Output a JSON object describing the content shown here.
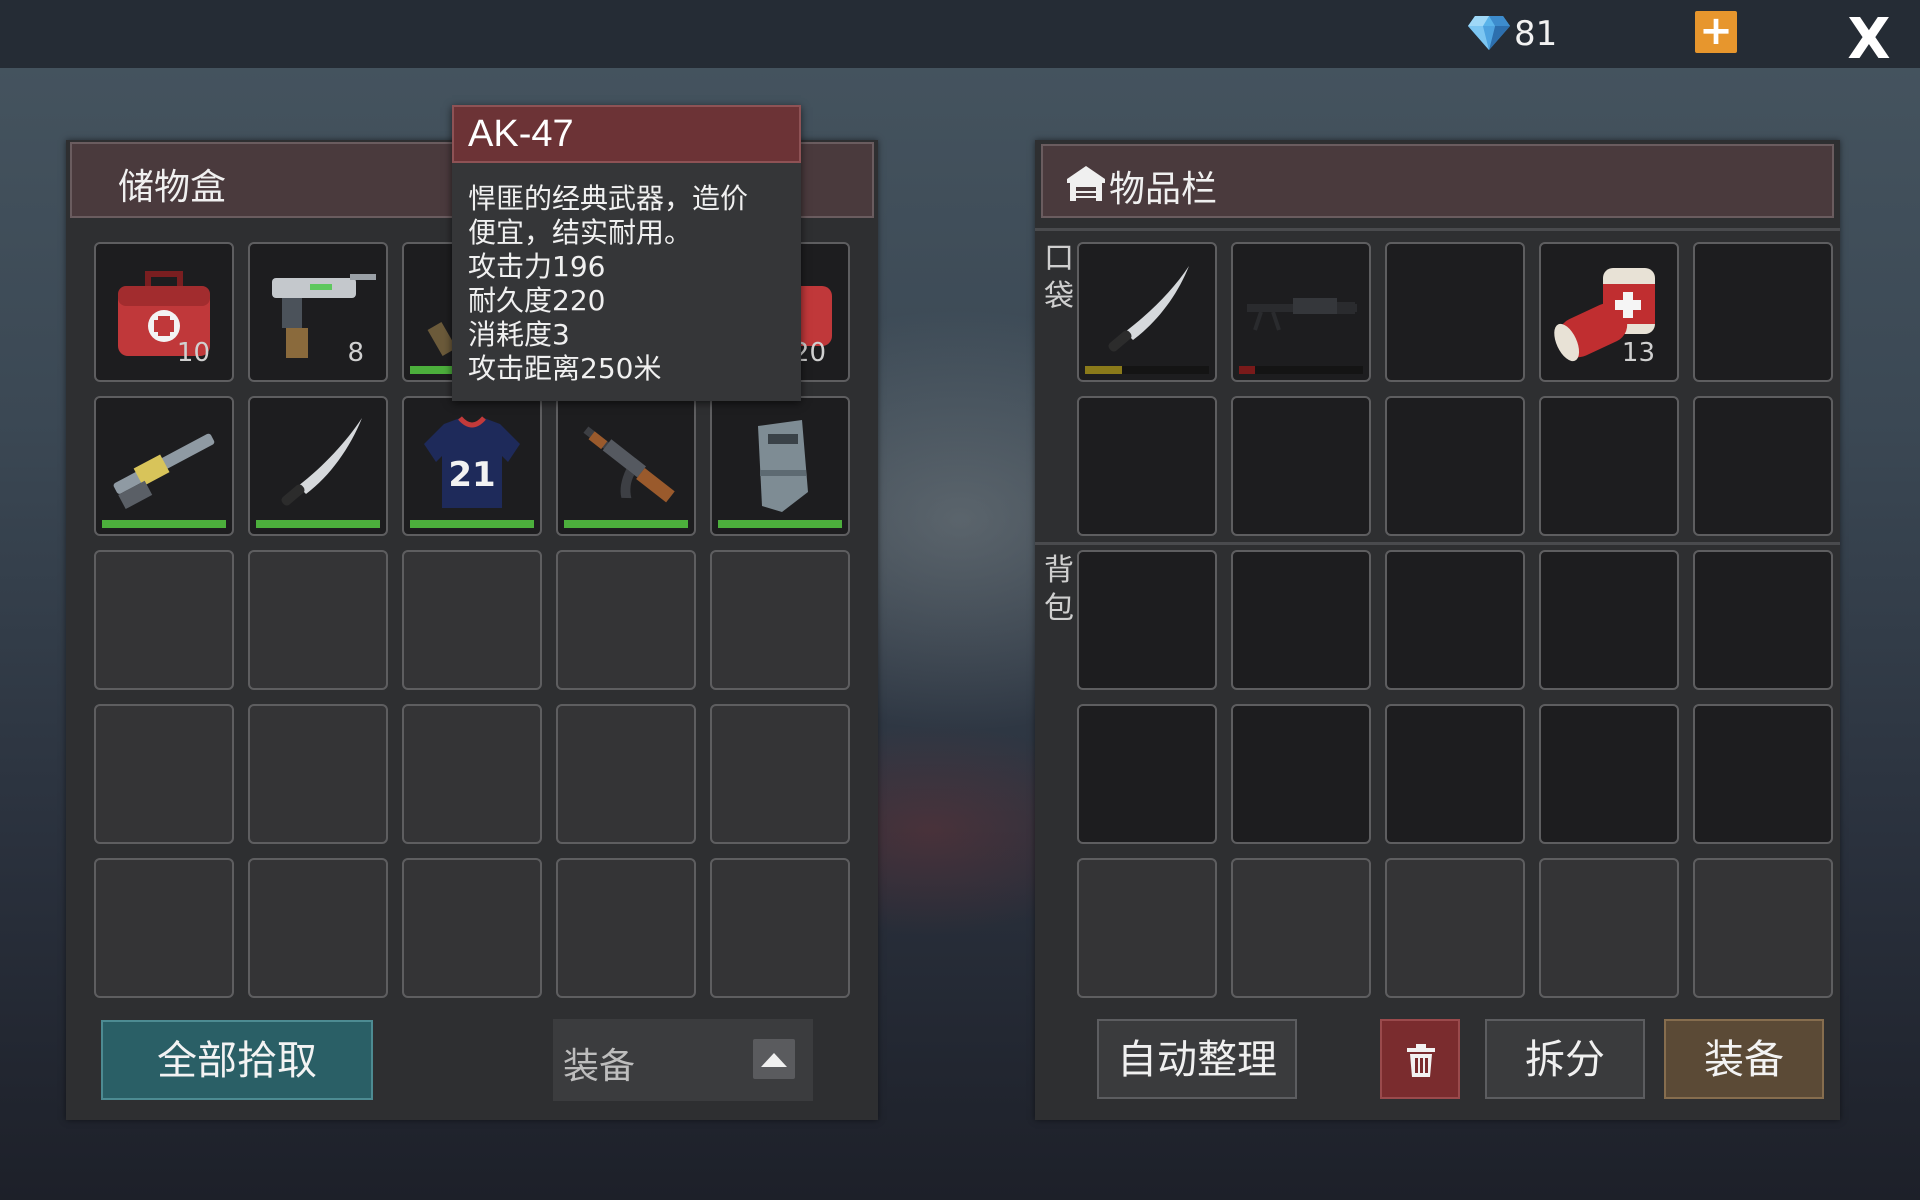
{
  "currency": {
    "gems": "81",
    "icon": "diamond-icon",
    "add_label": "+"
  },
  "close_label": "X",
  "storage": {
    "title": "储物盒",
    "row1": [
      {
        "icon": "first-aid-kit-icon",
        "qty": "10"
      },
      {
        "icon": "submachine-gun-icon",
        "qty": "8"
      },
      {
        "icon": "rifle-icon"
      },
      {
        "icon": "hidden-slot"
      },
      {
        "icon": "first-aid-kit-icon",
        "qty": "20"
      }
    ],
    "row2": [
      {
        "icon": "shotgun-icon",
        "durability": 1.0
      },
      {
        "icon": "machete-icon",
        "durability": 1.0
      },
      {
        "icon": "jersey-icon",
        "label": "21",
        "durability": 1.0
      },
      {
        "icon": "ak47-icon",
        "durability": 1.0
      },
      {
        "icon": "riot-shield-icon",
        "durability": 1.0
      }
    ],
    "pickup_all_label": "全部拾取",
    "filter": {
      "selected": "装备"
    }
  },
  "tooltip": {
    "title": "AK-47",
    "lines": [
      "悍匪的经典武器，造价",
      "便宜，结实耐用。",
      "攻击力196",
      "耐久度220",
      "消耗度3",
      "攻击距离250米"
    ]
  },
  "inventory": {
    "title": "物品栏",
    "pocket_label": [
      "口",
      "袋"
    ],
    "backpack_label": [
      "背",
      "包"
    ],
    "pocket_items": [
      {
        "icon": "machete-icon",
        "durability": 0.3,
        "dur_color": "#8a7a1a"
      },
      {
        "icon": "machine-gun-icon",
        "durability": 0.13,
        "dur_color": "#7a1a1a"
      },
      {
        "icon": "empty"
      },
      {
        "icon": "bandage-icon",
        "qty": "13"
      },
      {
        "icon": "empty"
      }
    ],
    "buttons": {
      "sort": "自动整理",
      "delete": "trash-icon",
      "split": "拆分",
      "equip": "装备"
    }
  },
  "colors": {
    "accent_teal": "#2a5f66",
    "equip_gold": "#5b4a36",
    "delete_red": "#7a2c2e",
    "durability_green": "#4caf3c"
  }
}
